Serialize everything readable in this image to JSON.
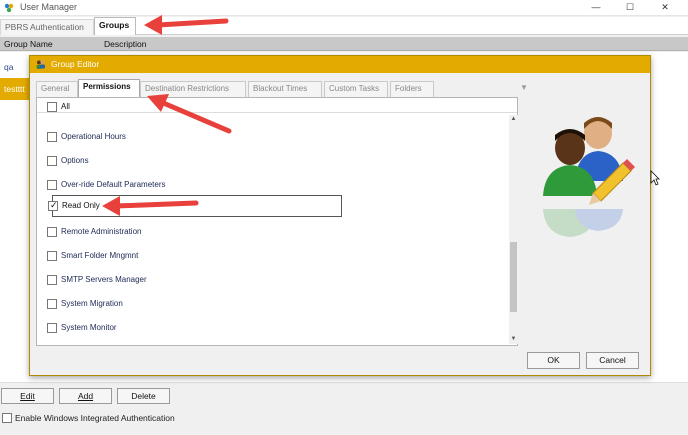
{
  "window": {
    "title": "User Manager",
    "minimize": "—",
    "maximize": "☐",
    "close": "✕"
  },
  "main_tabs": [
    "PBRS Authentication",
    "Groups"
  ],
  "grid": {
    "headers": [
      "Group Name",
      "Description"
    ],
    "rows": [
      "qa",
      "testttt"
    ]
  },
  "bottom": {
    "edit_label": "Edit",
    "add_label": "Add",
    "delete_label": "Delete",
    "windows_auth_label": "Enable Windows Integrated Authentication"
  },
  "dialog": {
    "title": "Group Editor",
    "tabs": [
      "General",
      "Permissions",
      "Destination Restrictions",
      "Blackout Times",
      "Custom Tasks",
      "Folders"
    ],
    "all_label": "All",
    "permissions": [
      {
        "label": "Operational Hours",
        "checked": false
      },
      {
        "label": "Options",
        "checked": false
      },
      {
        "label": "Over-ride Default Parameters",
        "checked": false
      },
      {
        "label": "Read Only",
        "checked": true
      },
      {
        "label": "Remote Administration",
        "checked": false
      },
      {
        "label": "Smart Folder Mngmnt",
        "checked": false
      },
      {
        "label": "SMTP Servers Manager",
        "checked": false
      },
      {
        "label": "System Migration",
        "checked": false
      },
      {
        "label": "System Monitor",
        "checked": false
      }
    ],
    "ok_label": "OK",
    "cancel_label": "Cancel"
  },
  "colors": {
    "accent": "#e3aa00",
    "annotation_arrow": "#e8413c"
  }
}
